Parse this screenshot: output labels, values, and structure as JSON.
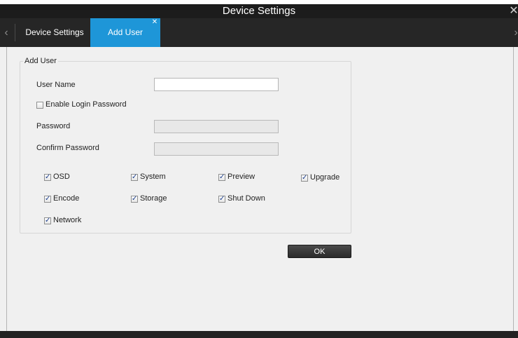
{
  "window": {
    "title": "Device Settings",
    "close_glyph": "✕"
  },
  "tabs": {
    "left_arrow": "‹",
    "right_arrow": "›",
    "items": [
      {
        "label": "Device Settings",
        "active": false
      },
      {
        "label": "Add User",
        "active": true,
        "close_glyph": "✕"
      }
    ]
  },
  "form": {
    "group_title": "Add User",
    "user_name": {
      "label": "User Name",
      "value": ""
    },
    "enable_login_password": {
      "label": "Enable Login Password",
      "checked": false
    },
    "password": {
      "label": "Password",
      "value": "",
      "disabled": true
    },
    "confirm_password": {
      "label": "Confirm Password",
      "value": "",
      "disabled": true
    },
    "permissions": [
      {
        "label": "OSD",
        "checked": true
      },
      {
        "label": "System",
        "checked": true
      },
      {
        "label": "Preview",
        "checked": true
      },
      {
        "label": "Upgrade",
        "checked": true
      },
      {
        "label": "Encode",
        "checked": true
      },
      {
        "label": "Storage",
        "checked": true
      },
      {
        "label": "Shut Down",
        "checked": true
      },
      {
        "label": "Network",
        "checked": true
      }
    ],
    "ok_label": "OK"
  },
  "colors": {
    "titlebar": "#1c1c1c",
    "tabbar": "#262626",
    "active_tab": "#1e96d8",
    "panel_bg": "#f0f0f0"
  }
}
